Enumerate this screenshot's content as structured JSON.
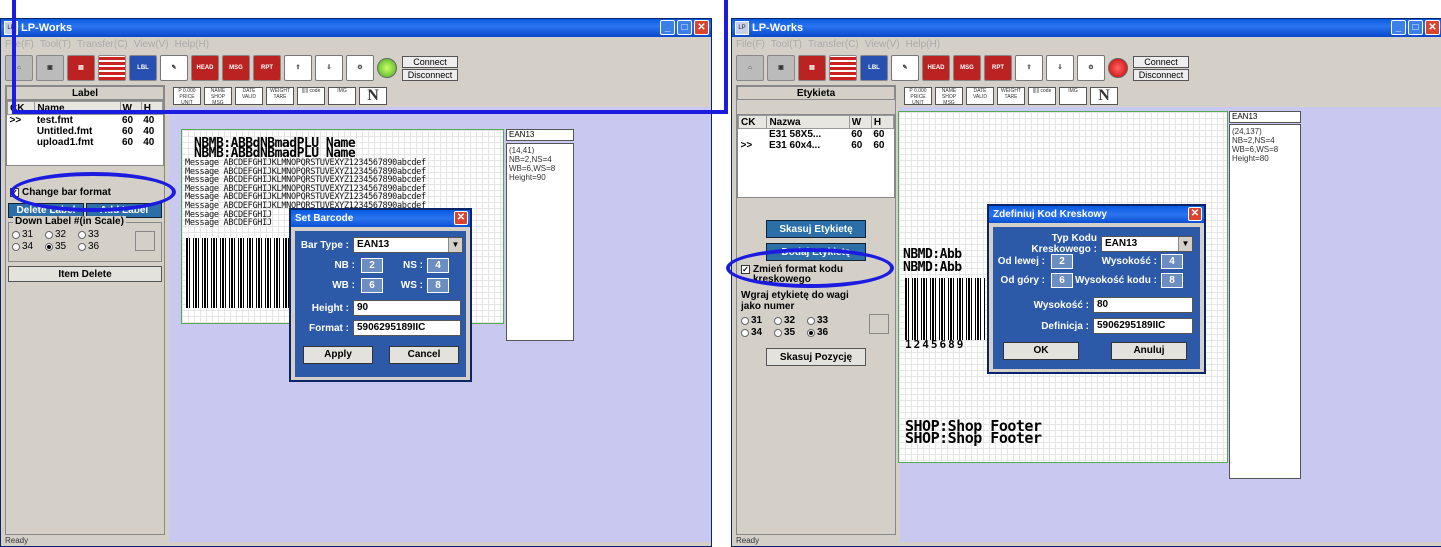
{
  "left_window": {
    "title": "LP-Works",
    "menu": [
      "File(F)",
      "Tool(T)",
      "Transfer(C)",
      "View(V)",
      "Help(H)"
    ],
    "connect": "Connect",
    "disconnect": "Disconnect",
    "panel_title": "Label",
    "columns": [
      "CK",
      "Name",
      "W",
      "H"
    ],
    "files": [
      {
        "ck": ">>",
        "name": "test.fmt",
        "w": "60",
        "h": "40"
      },
      {
        "ck": "",
        "name": "Untitled.fmt",
        "w": "60",
        "h": "40"
      },
      {
        "ck": "",
        "name": "upload1.fmt",
        "w": "60",
        "h": "40"
      }
    ],
    "change_bar_format": "Change bar format",
    "delete_label": "Delete Label",
    "add_label": "Add Label",
    "down_label_group": "Down Label #(in Scale)",
    "radios": [
      "31",
      "32",
      "33",
      "34",
      "35",
      "36"
    ],
    "radio_selected": "35",
    "item_delete": "Item Delete",
    "info_header": "EAN13",
    "info_lines": [
      "(14,41)",
      "NB=2,NS=4",
      "WB=6,WS=8",
      "Height=90"
    ],
    "label_big1": "NBMB:ABBdNBmadPLU Name",
    "label_big2": "NBMB:ABBdNBmadPLU Name",
    "message_lines": [
      "Message ABCDEFGHIJKLMNOPQRSTUVEXYZ1234567890abcdef",
      "Message ABCDEFGHIJKLMNOPQRSTUVEXYZ1234567890abcdef",
      "Message ABCDEFGHIJKLMNOPQRSTUVEXYZ1234567890abcdef",
      "Message ABCDEFGHIJKLMNOPQRSTUVEXYZ1234567890abcdef",
      "Message ABCDEFGHIJKLMNOPQRSTUVEXYZ1234567890abcdef",
      "Message ABCDEFGHIJKLMNOPQRSTUVEXYZ1234567890abcdef",
      "Message ABCDEFGHIJ",
      "Message ABCDEFGHIJ"
    ],
    "dialog": {
      "title": "Set Barcode",
      "bar_type_label": "Bar Type :",
      "bar_type": "EAN13",
      "nb_label": "NB :",
      "nb": "2",
      "ns_label": "NS :",
      "ns": "4",
      "wb_label": "WB :",
      "wb": "6",
      "ws_label": "WS :",
      "ws": "8",
      "height_label": "Height :",
      "height": "90",
      "format_label": "Format :",
      "format": "5906295189IIC",
      "apply": "Apply",
      "cancel": "Cancel"
    },
    "status": "Ready"
  },
  "right_window": {
    "title": "LP-Works",
    "menu": [
      "File(F)",
      "Tool(T)",
      "Transfer(C)",
      "View(V)",
      "Help(H)"
    ],
    "connect": "Connect",
    "disconnect": "Disconnect",
    "panel_title": "Etykieta",
    "columns": [
      "CK",
      "Nazwa",
      "W",
      "H"
    ],
    "files": [
      {
        "ck": "",
        "name": "E31 58X5...",
        "w": "60",
        "h": "60"
      },
      {
        "ck": ">>",
        "name": "E31 60x4...",
        "w": "60",
        "h": "60"
      }
    ],
    "delete_label": "Skasuj Etykietę",
    "add_label": "Dodaj Etykietę",
    "change_bar_format": "Zmień format kodu kreskowego",
    "down_label_group": "Wgraj etykietę do wagi jako numer",
    "radios": [
      "31",
      "32",
      "33",
      "34",
      "35",
      "36"
    ],
    "radio_selected": "36",
    "item_delete": "Skasuj Pozycję",
    "info_header": "EAN13",
    "info_lines": [
      "(24,137)",
      "NB=2,NS=4",
      "WB=6,WS=8",
      "Height=80"
    ],
    "label_big1": "NBMD:Abb",
    "label_big2": "NBMD:Abb",
    "barcode_digits": "1245689",
    "footer1": "SHOP:Shop Footer",
    "footer2": "SHOP:Shop Footer",
    "dialog": {
      "title": "Zdefiniuj Kod Kreskowy",
      "bar_type_label": "Typ Kodu Kreskowego :",
      "bar_type": "EAN13",
      "nb_label": "Od lewej :",
      "nb": "2",
      "ns_label": "Wysokość :",
      "ns": "4",
      "wb_label": "Od góry :",
      "wb": "6",
      "ws_label": "Wysokość kodu :",
      "ws": "8",
      "height_label": "Wysokość :",
      "height": "80",
      "format_label": "Definicja :",
      "format": "5906295189IIC",
      "apply": "OK",
      "cancel": "Anuluj"
    },
    "status": "Ready"
  },
  "colors": {
    "annotation": "#1c1ce0",
    "canvas": "#c8c8f0",
    "titlebar": "#0a5be0"
  }
}
